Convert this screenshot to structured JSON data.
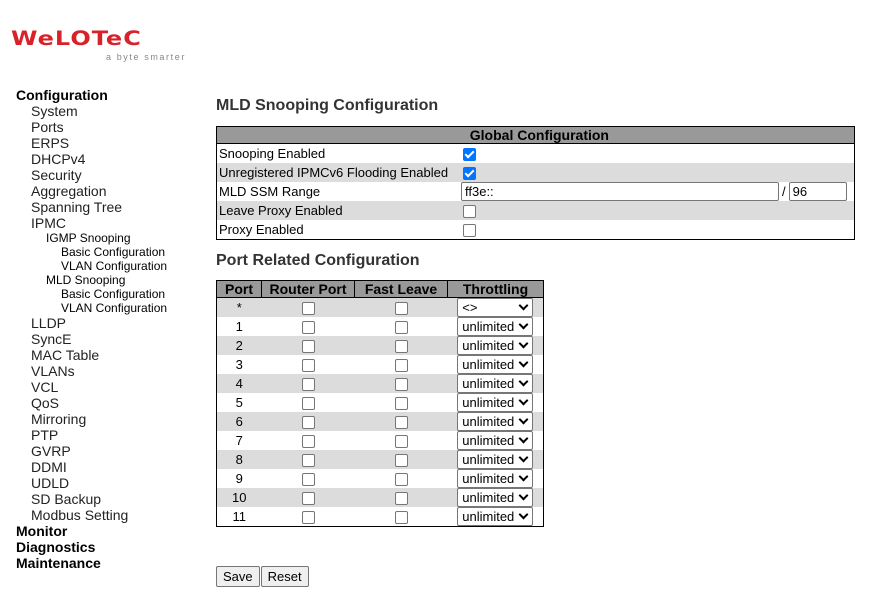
{
  "logo": {
    "brand": "WeLOTeC",
    "tagline": "a byte smarter"
  },
  "sidebar": {
    "items": [
      {
        "label": "Configuration",
        "level": 0
      },
      {
        "label": "System",
        "level": 1
      },
      {
        "label": "Ports",
        "level": 1
      },
      {
        "label": "ERPS",
        "level": 1
      },
      {
        "label": "DHCPv4",
        "level": 1
      },
      {
        "label": "Security",
        "level": 1
      },
      {
        "label": "Aggregation",
        "level": 1
      },
      {
        "label": "Spanning Tree",
        "level": 1
      },
      {
        "label": "IPMC",
        "level": 1
      },
      {
        "label": "IGMP Snooping",
        "level": 2
      },
      {
        "label": "Basic Configuration",
        "level": 3
      },
      {
        "label": "VLAN Configuration",
        "level": 3
      },
      {
        "label": "MLD Snooping",
        "level": 2
      },
      {
        "label": "Basic Configuration",
        "level": 3
      },
      {
        "label": "VLAN Configuration",
        "level": 3
      },
      {
        "label": "LLDP",
        "level": 1
      },
      {
        "label": "SyncE",
        "level": 1
      },
      {
        "label": "MAC Table",
        "level": 1
      },
      {
        "label": "VLANs",
        "level": 1
      },
      {
        "label": "VCL",
        "level": 1
      },
      {
        "label": "QoS",
        "level": 1
      },
      {
        "label": "Mirroring",
        "level": 1
      },
      {
        "label": "PTP",
        "level": 1
      },
      {
        "label": "GVRP",
        "level": 1
      },
      {
        "label": "DDMI",
        "level": 1
      },
      {
        "label": "UDLD",
        "level": 1
      },
      {
        "label": "SD Backup",
        "level": 1
      },
      {
        "label": "Modbus Setting",
        "level": 1
      },
      {
        "label": "Monitor",
        "level": 0
      },
      {
        "label": "Diagnostics",
        "level": 0
      },
      {
        "label": "Maintenance",
        "level": 0
      }
    ]
  },
  "page": {
    "title": "MLD Snooping Configuration"
  },
  "global": {
    "header": "Global Configuration",
    "snooping_enabled": {
      "label": "Snooping Enabled",
      "checked": true
    },
    "unregistered_flooding": {
      "label": "Unregistered IPMCv6 Flooding Enabled",
      "checked": true
    },
    "ssm_range": {
      "label": "MLD SSM Range",
      "prefix": "ff3e::",
      "separator": "/",
      "length": "96"
    },
    "leave_proxy": {
      "label": "Leave Proxy Enabled",
      "checked": false
    },
    "proxy": {
      "label": "Proxy Enabled",
      "checked": false
    }
  },
  "ports": {
    "title": "Port Related Configuration",
    "headers": {
      "port": "Port",
      "router": "Router Port",
      "fast": "Fast Leave",
      "throttling": "Throttling"
    },
    "rows": [
      {
        "port": "*",
        "router": false,
        "fast": false,
        "throttling": "<>"
      },
      {
        "port": "1",
        "router": false,
        "fast": false,
        "throttling": "unlimited"
      },
      {
        "port": "2",
        "router": false,
        "fast": false,
        "throttling": "unlimited"
      },
      {
        "port": "3",
        "router": false,
        "fast": false,
        "throttling": "unlimited"
      },
      {
        "port": "4",
        "router": false,
        "fast": false,
        "throttling": "unlimited"
      },
      {
        "port": "5",
        "router": false,
        "fast": false,
        "throttling": "unlimited"
      },
      {
        "port": "6",
        "router": false,
        "fast": false,
        "throttling": "unlimited"
      },
      {
        "port": "7",
        "router": false,
        "fast": false,
        "throttling": "unlimited"
      },
      {
        "port": "8",
        "router": false,
        "fast": false,
        "throttling": "unlimited"
      },
      {
        "port": "9",
        "router": false,
        "fast": false,
        "throttling": "unlimited"
      },
      {
        "port": "10",
        "router": false,
        "fast": false,
        "throttling": "unlimited"
      },
      {
        "port": "11",
        "router": false,
        "fast": false,
        "throttling": "unlimited"
      }
    ]
  },
  "buttons": {
    "save": "Save",
    "reset": "Reset"
  }
}
